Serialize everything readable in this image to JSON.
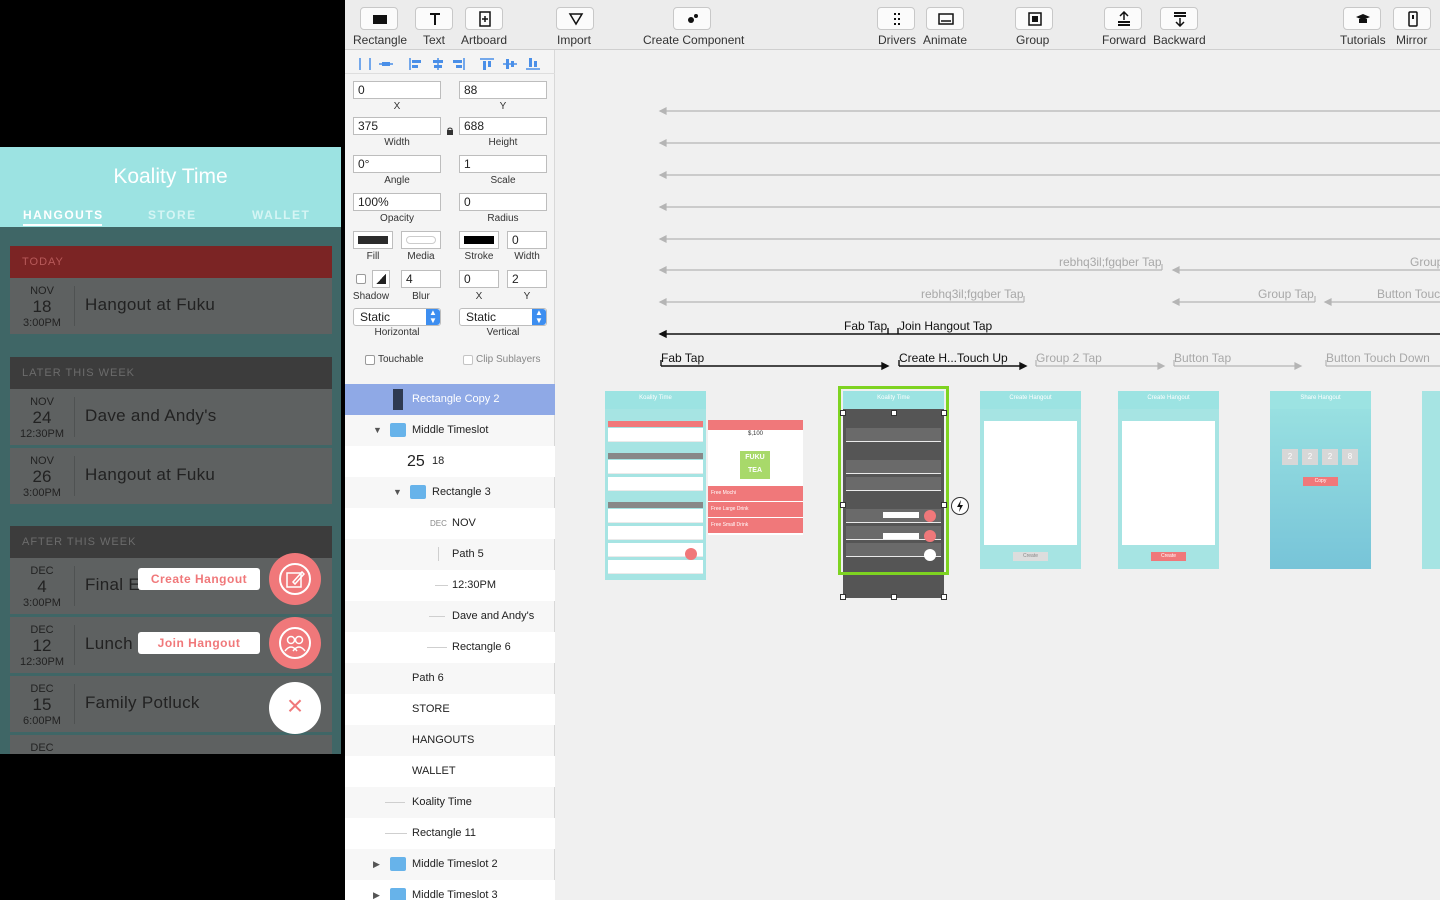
{
  "toolbar": {
    "rectangle": "Rectangle",
    "text": "Text",
    "artboard": "Artboard",
    "import": "Import",
    "create_component": "Create Component",
    "drivers": "Drivers",
    "animate": "Animate",
    "group": "Group",
    "forward": "Forward",
    "backward": "Backward",
    "tutorials": "Tutorials",
    "mirror": "Mirror"
  },
  "inspector": {
    "x_value": "0",
    "x_label": "X",
    "y_value": "88",
    "y_label": "Y",
    "width_value": "375",
    "width_label": "Width",
    "height_value": "688",
    "height_label": "Height",
    "angle_value": "0°",
    "angle_label": "Angle",
    "scale_value": "1",
    "scale_label": "Scale",
    "opacity_value": "100%",
    "opacity_label": "Opacity",
    "radius_value": "0",
    "radius_label": "Radius",
    "fill_label": "Fill",
    "media_label": "Media",
    "stroke_label": "Stroke",
    "stroke_width_value": "0",
    "stroke_width_label": "Width",
    "shadow_label": "Shadow",
    "blur_value": "4",
    "blur_label": "Blur",
    "shadow_x_value": "0",
    "shadow_x_label": "X",
    "shadow_y_value": "2",
    "shadow_y_label": "Y",
    "horizontal_value": "Static",
    "horizontal_label": "Horizontal",
    "vertical_value": "Static",
    "vertical_label": "Vertical",
    "touchable_label": "Touchable",
    "clip_sublayers_label": "Clip Sublayers"
  },
  "layers": [
    {
      "label": "Rectangle Copy 2"
    },
    {
      "label": "Middle Timeslot"
    },
    {
      "label": "25",
      "sub": "18"
    },
    {
      "label": "Rectangle 3"
    },
    {
      "label": "NOV",
      "prefix": "DEC"
    },
    {
      "label": "Path 5"
    },
    {
      "label": "12:30PM"
    },
    {
      "label": "Dave and Andy's"
    },
    {
      "label": "Rectangle 6"
    },
    {
      "label": "Path 6"
    },
    {
      "label": "STORE"
    },
    {
      "label": "HANGOUTS"
    },
    {
      "label": "WALLET"
    },
    {
      "label": "Koality Time"
    },
    {
      "label": "Rectangle 11"
    },
    {
      "label": "Middle Timeslot 2"
    },
    {
      "label": "Middle Timeslot 3"
    }
  ],
  "preview": {
    "title": "Koality Time",
    "tabs": [
      "HANGOUTS",
      "STORE",
      "WALLET"
    ],
    "sections": [
      "TODAY",
      "LATER THIS WEEK",
      "AFTER THIS WEEK"
    ],
    "rows": [
      {
        "month": "NOV",
        "day": "18",
        "time": "3:00PM",
        "name": "Hangout at Fuku"
      },
      {
        "month": "NOV",
        "day": "24",
        "time": "12:30PM",
        "name": "Dave and Andy's"
      },
      {
        "month": "NOV",
        "day": "26",
        "time": "3:00PM",
        "name": "Hangout at Fuku"
      },
      {
        "month": "DEC",
        "day": "4",
        "time": "3:00PM",
        "name": "Final Exam Cram"
      },
      {
        "month": "DEC",
        "day": "12",
        "time": "12:30PM",
        "name": "Lunch"
      },
      {
        "month": "DEC",
        "day": "15",
        "time": "6:00PM",
        "name": "Family Potluck"
      },
      {
        "month": "DEC",
        "day": "",
        "time": "",
        "name": ""
      }
    ],
    "create_hangout": "Create Hangout",
    "join_hangout": "Join Hangout",
    "close_glyph": "×"
  },
  "canvas": {
    "connections": [
      "rebhq3il;fgqber Tap",
      "Group",
      "rebhq3il;fgqber Tap",
      "Group Tap",
      "Button Touc",
      "Fab Tap",
      "Join Hangout Tap",
      "Fab Tap",
      "Create H...Touch Up",
      "Group 2 Tap",
      "Button Tap",
      "Button Touch Down"
    ],
    "mini_title": "Koality Time",
    "mini_create": "Create Hangout",
    "mini_share": "Share Hangout",
    "mini_code": [
      "2",
      "2",
      "2",
      "8"
    ],
    "mini_copy": "Copy",
    "mini_create_btn": "Create",
    "store_amount": "$,100",
    "store_items": [
      "Free Mochi",
      "Free Large Drink",
      "Free Small Drink"
    ],
    "store_logo": "FUKU TEA"
  },
  "colors": {
    "accent_teal": "#9ce3e2",
    "accent_pink": "#f0787a",
    "selection_green": "#7ed321",
    "layer_selected": "#8fa9e6"
  }
}
